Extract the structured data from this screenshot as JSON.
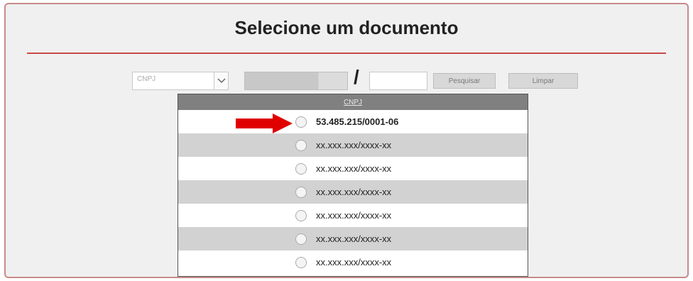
{
  "page": {
    "title": "Selecione um documento"
  },
  "search": {
    "doc_type_value": "CNPJ",
    "separator": "/",
    "search_label": "Pesquisar",
    "clear_label": "Limpar"
  },
  "results": {
    "header": "CNPJ",
    "rows": [
      {
        "value": "53.485.215/0001-06",
        "selected": true
      },
      {
        "value": "xx.xxx.xxx/xxxx-xx",
        "selected": false
      },
      {
        "value": "xx.xxx.xxx/xxxx-xx",
        "selected": false
      },
      {
        "value": "xx.xxx.xxx/xxxx-xx",
        "selected": false
      },
      {
        "value": "xx.xxx.xxx/xxxx-xx",
        "selected": false
      },
      {
        "value": "xx.xxx.xxx/xxxx-xx",
        "selected": false
      },
      {
        "value": "xx.xxx.xxx/xxxx-xx",
        "selected": false
      }
    ]
  },
  "colors": {
    "accent_line": "#c94a4a",
    "arrow": "#e00000",
    "panel_border": "#c98a8a",
    "header_bg": "#808080"
  },
  "icons": {
    "arrow": "right-arrow-icon",
    "dropdown": "chevron-down-icon"
  }
}
